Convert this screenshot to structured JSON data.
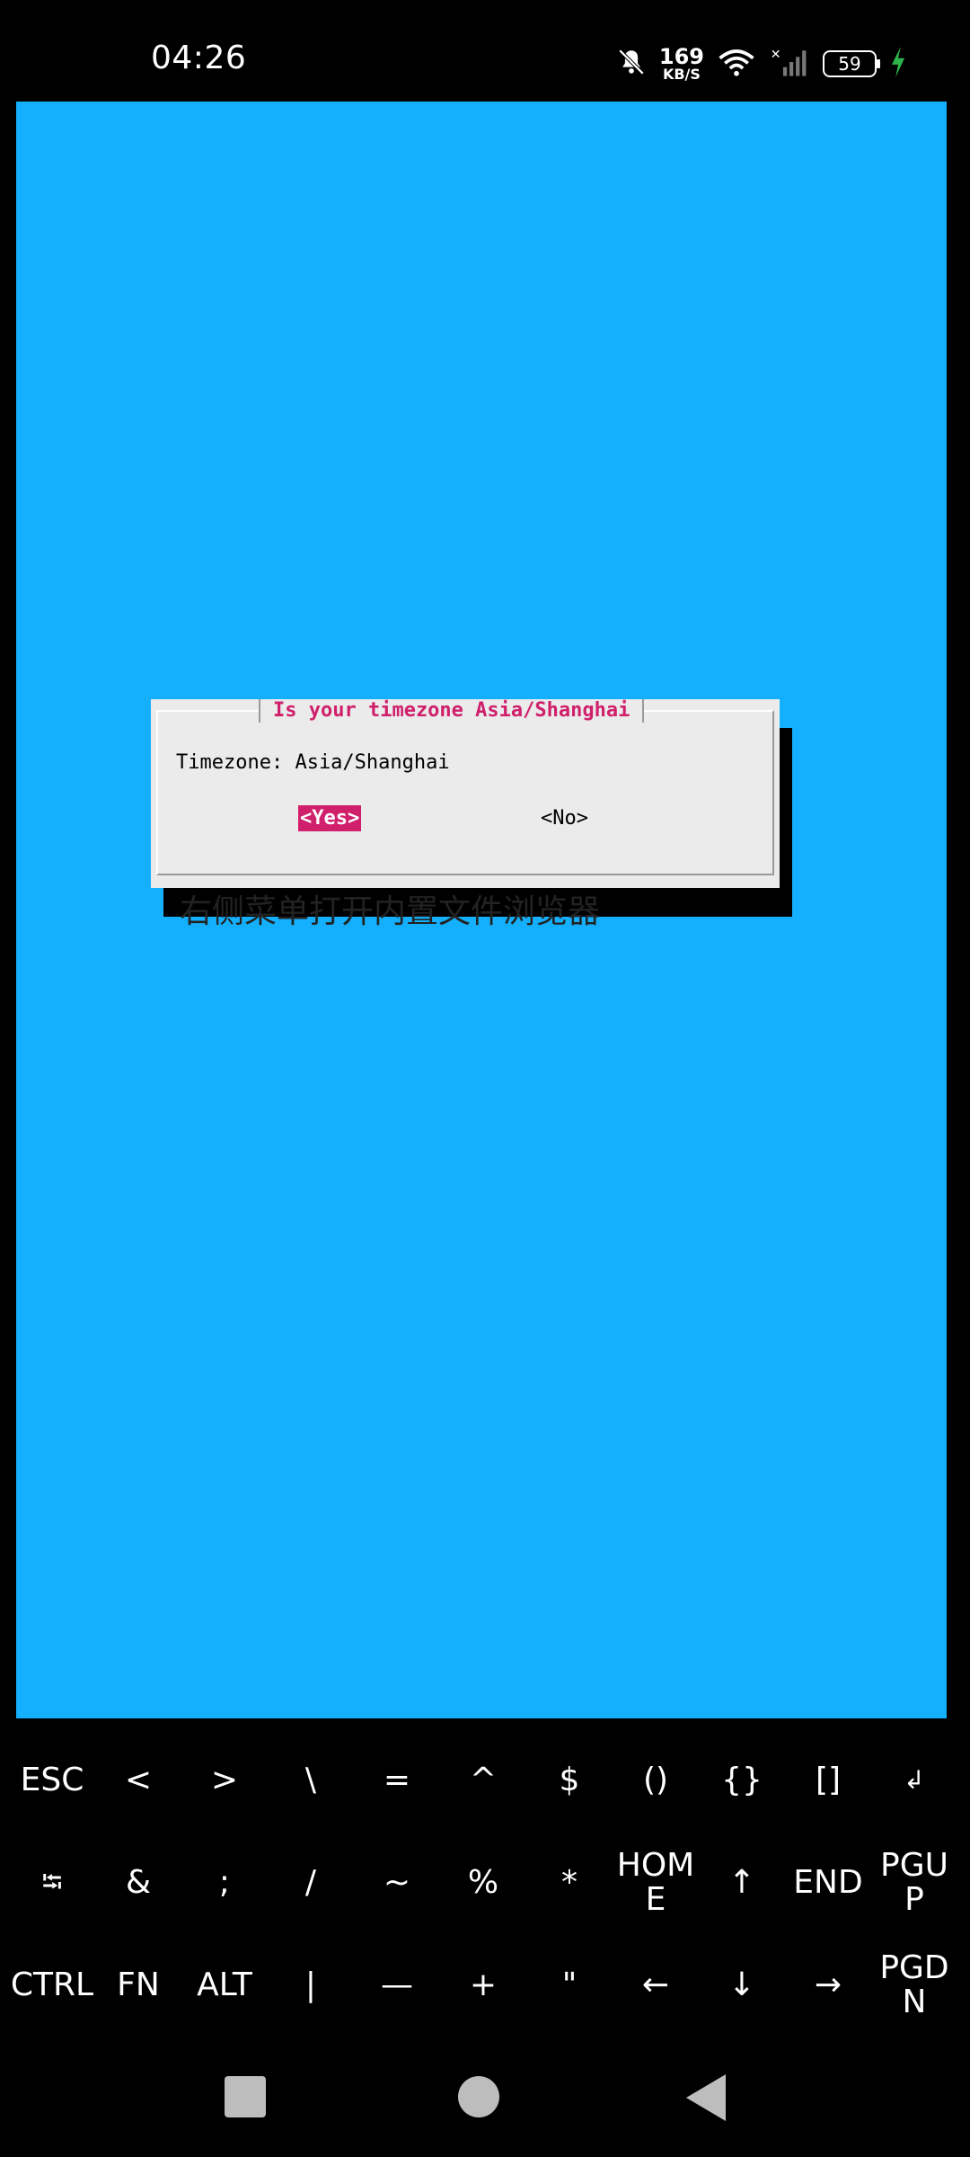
{
  "status_bar": {
    "time": "04:26",
    "net_speed_value": "169",
    "net_speed_unit": "KB/S",
    "battery": "59",
    "icons": [
      "bell-muted-icon",
      "wifi-icon",
      "signal-icon",
      "charging-bolt-icon"
    ]
  },
  "terminal": {
    "background_color": "#15b0fd",
    "background_overlay_text": "右侧菜单打开内置文件浏览器",
    "dialog": {
      "title": "Is your timezone Asia/Shanghai",
      "message": "Timezone: Asia/Shanghai",
      "yes_label": "<Yes>",
      "no_label": "<No>",
      "accent_color": "#d0206c"
    }
  },
  "extra_keys": {
    "row1": [
      "ESC",
      "<",
      ">",
      "\\",
      "=",
      "^",
      "$",
      "()",
      "{}",
      "[]",
      "↲"
    ],
    "row2": [
      "⭾",
      "&",
      ";",
      "/",
      "~",
      "%",
      "*",
      "HOME",
      "↑",
      "END",
      "PGUP"
    ],
    "row3": [
      "CTRL",
      "FN",
      "ALT",
      "|",
      "—",
      "+",
      "\"",
      "←",
      "↓",
      "→",
      "PGDN"
    ]
  },
  "nav_bar": {
    "buttons": [
      "recents",
      "home",
      "back"
    ]
  }
}
